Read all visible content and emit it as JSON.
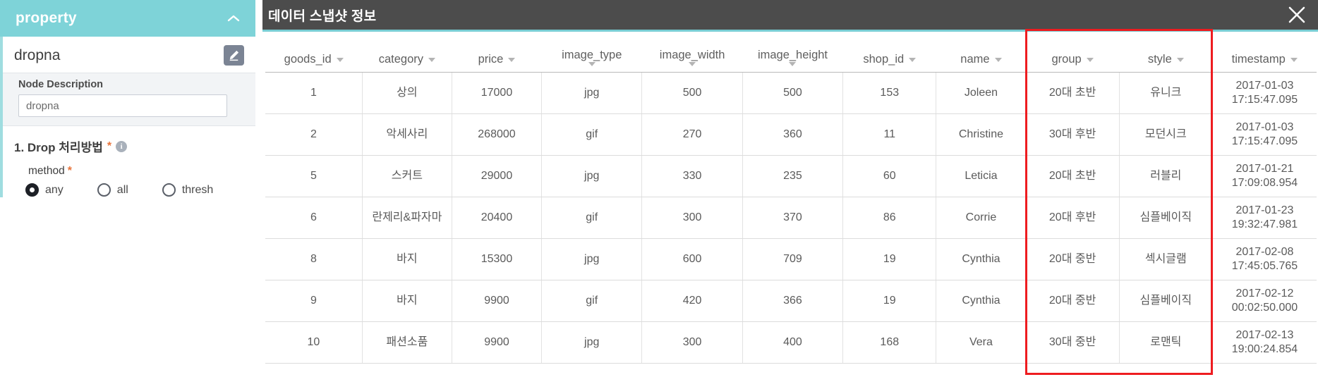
{
  "property_panel": {
    "header_title": "property",
    "collapse_icon": "chevron-up-icon",
    "node_title": "dropna",
    "node_icon": "edit-node-icon",
    "description_label": "Node Description",
    "description_value": "dropna",
    "description_placeholder": "",
    "section_number_title": "1. Drop 처리방법",
    "required_mark": "*",
    "info_icon_glyph": "i",
    "field_label": "method",
    "radio_options": [
      {
        "label": "any",
        "selected": true
      },
      {
        "label": "all",
        "selected": false
      },
      {
        "label": "thresh",
        "selected": false
      }
    ]
  },
  "snapshot_panel": {
    "title": "데이터 스냅샷 정보",
    "close_icon": "close-icon",
    "accent_color": "#79cdd4",
    "header_bg": "#4c4c4c",
    "highlight_color": "#ee1c20",
    "highlighted_columns": [
      "group",
      "style"
    ],
    "columns": [
      {
        "label": "goods_id",
        "caret": true,
        "stacked": false
      },
      {
        "label": "category",
        "caret": true,
        "stacked": false
      },
      {
        "label": "price",
        "caret": true,
        "stacked": false
      },
      {
        "label": "image_type",
        "caret": true,
        "stacked": true
      },
      {
        "label": "image_width",
        "caret": true,
        "stacked": true
      },
      {
        "label": "image_height",
        "caret": true,
        "stacked": true
      },
      {
        "label": "shop_id",
        "caret": true,
        "stacked": false
      },
      {
        "label": "name",
        "caret": true,
        "stacked": false
      },
      {
        "label": "group",
        "caret": true,
        "stacked": false
      },
      {
        "label": "style",
        "caret": true,
        "stacked": false
      },
      {
        "label": "timestamp",
        "caret": true,
        "stacked": false
      }
    ],
    "rows": [
      {
        "goods_id": "1",
        "category": "상의",
        "price": "17000",
        "image_type": "jpg",
        "image_width": "500",
        "image_height": "500",
        "shop_id": "153",
        "name": "Joleen",
        "group": "20대 초반",
        "style": "유니크",
        "ts_date": "2017-01-03",
        "ts_time": "17:15:47.095"
      },
      {
        "goods_id": "2",
        "category": "악세사리",
        "price": "268000",
        "image_type": "gif",
        "image_width": "270",
        "image_height": "360",
        "shop_id": "11",
        "name": "Christine",
        "group": "30대 후반",
        "style": "모던시크",
        "ts_date": "2017-01-03",
        "ts_time": "17:15:47.095"
      },
      {
        "goods_id": "5",
        "category": "스커트",
        "price": "29000",
        "image_type": "jpg",
        "image_width": "330",
        "image_height": "235",
        "shop_id": "60",
        "name": "Leticia",
        "group": "20대 초반",
        "style": "러블리",
        "ts_date": "2017-01-21",
        "ts_time": "17:09:08.954"
      },
      {
        "goods_id": "6",
        "category": "란제리&파자마",
        "price": "20400",
        "image_type": "gif",
        "image_width": "300",
        "image_height": "370",
        "shop_id": "86",
        "name": "Corrie",
        "group": "20대 후반",
        "style": "심플베이직",
        "ts_date": "2017-01-23",
        "ts_time": "19:32:47.981"
      },
      {
        "goods_id": "8",
        "category": "바지",
        "price": "15300",
        "image_type": "jpg",
        "image_width": "600",
        "image_height": "709",
        "shop_id": "19",
        "name": "Cynthia",
        "group": "20대 중반",
        "style": "섹시글램",
        "ts_date": "2017-02-08",
        "ts_time": "17:45:05.765"
      },
      {
        "goods_id": "9",
        "category": "바지",
        "price": "9900",
        "image_type": "gif",
        "image_width": "420",
        "image_height": "366",
        "shop_id": "19",
        "name": "Cynthia",
        "group": "20대 중반",
        "style": "심플베이직",
        "ts_date": "2017-02-12",
        "ts_time": "00:02:50.000"
      },
      {
        "goods_id": "10",
        "category": "패션소품",
        "price": "9900",
        "image_type": "jpg",
        "image_width": "300",
        "image_height": "400",
        "shop_id": "168",
        "name": "Vera",
        "group": "30대 중반",
        "style": "로맨틱",
        "ts_date": "2017-02-13",
        "ts_time": "19:00:24.854"
      }
    ]
  }
}
